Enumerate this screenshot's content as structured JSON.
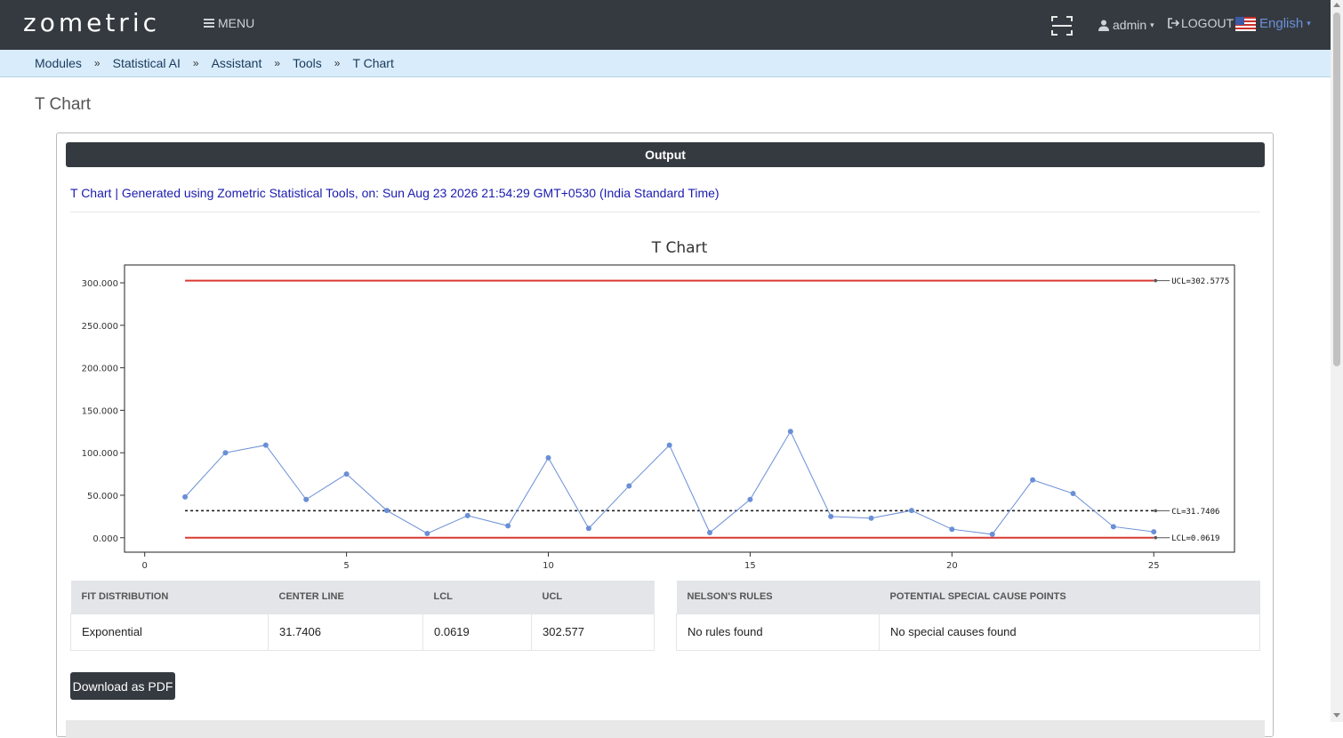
{
  "header": {
    "logo": "zometric",
    "menu_label": "MENU",
    "user_label": "admin",
    "logout_label": "LOGOUT",
    "language_label": "English",
    "scan_icon": "scan-icon"
  },
  "breadcrumb": [
    "Modules",
    "Statistical AI",
    "Assistant",
    "Tools",
    "T Chart"
  ],
  "page_title": "T Chart",
  "output": {
    "header_label": "Output",
    "generated_text": "T Chart | Generated using Zometric Statistical Tools, on: Sun Aug 23 2026 21:54:29 GMT+0530 (India Standard Time)"
  },
  "chart_data": {
    "type": "line",
    "title": "T Chart",
    "xlabel": "",
    "ylabel": "",
    "xlim": [
      -0.5,
      27
    ],
    "ylim": [
      -17,
      321
    ],
    "x_ticks": [
      0,
      5,
      10,
      15,
      20,
      25
    ],
    "y_ticks": [
      0,
      50,
      100,
      150,
      200,
      250,
      300
    ],
    "y_tick_labels": [
      "0.000",
      "50.000",
      "100.000",
      "150.000",
      "200.000",
      "250.000",
      "300.000"
    ],
    "series": [
      {
        "x": [
          1,
          2,
          3,
          4,
          5,
          6,
          7,
          8,
          9,
          10,
          11,
          12,
          13,
          14,
          15,
          16,
          17,
          18,
          19,
          20,
          21,
          22,
          23,
          24,
          25
        ],
        "values": [
          48,
          100,
          109,
          45,
          75,
          32,
          5,
          26,
          14,
          94,
          11,
          61,
          109,
          6,
          45,
          125,
          25,
          23,
          32,
          10,
          4,
          68,
          52,
          13,
          7
        ],
        "color": "#6a8fd6"
      }
    ],
    "control_lines": [
      {
        "label": "UCL=302.5775",
        "value": 302.5775,
        "color": "#d93a32",
        "style": "solid"
      },
      {
        "label": "CL=31.7406",
        "value": 31.7406,
        "color": "#111111",
        "style": "dotted"
      },
      {
        "label": "LCL=0.0619",
        "value": 0.0619,
        "color": "#d93a32",
        "style": "solid"
      }
    ],
    "grid": false
  },
  "stats_table": {
    "headers": [
      "FIT DISTRIBUTION",
      "CENTER LINE",
      "LCL",
      "UCL"
    ],
    "row": [
      "Exponential",
      "31.7406",
      "0.0619",
      "302.577"
    ]
  },
  "nelson_table": {
    "headers": [
      "NELSON'S RULES",
      "POTENTIAL SPECIAL CAUSE POINTS"
    ],
    "row": [
      "No rules found",
      "No special causes found"
    ]
  },
  "download_label": "Download as PDF"
}
